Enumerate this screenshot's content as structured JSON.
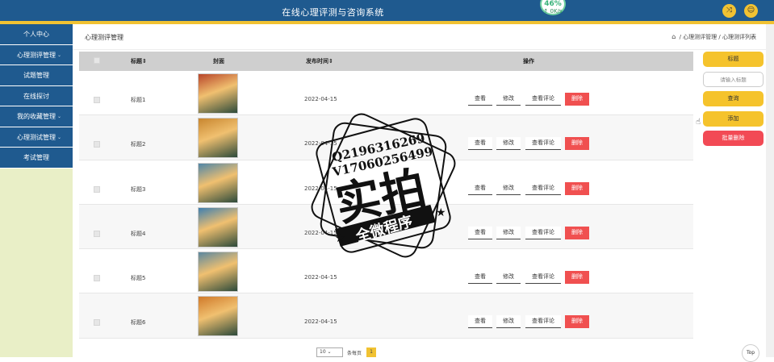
{
  "app": {
    "title": "在线心理评测与咨询系统"
  },
  "speed": {
    "value": "46%",
    "rate": "↑ 0K/s"
  },
  "topbar_icons": [
    "shuffle-icon",
    "user-icon"
  ],
  "sidebar": {
    "items": [
      {
        "label": "个人中心",
        "caret": false
      },
      {
        "label": "心理测评管理",
        "caret": true
      },
      {
        "label": "试题管理",
        "caret": false
      },
      {
        "label": "在线探讨",
        "caret": false
      },
      {
        "label": "我的收藏管理",
        "caret": true
      },
      {
        "label": "心理测试管理",
        "caret": true
      },
      {
        "label": "考试管理",
        "caret": false
      }
    ]
  },
  "content": {
    "page_title": "心理测评管理",
    "breadcrumb": [
      "心理测评管理",
      "心理测评列表"
    ],
    "breadcrumb_sep": "/"
  },
  "table": {
    "headers": {
      "title": "标题",
      "cover": "封面",
      "publish_time": "发布时间",
      "actions": "操作"
    },
    "rows": [
      {
        "title": "标题1",
        "date": "2022-04-15",
        "cover_color": "#b8452a"
      },
      {
        "title": "标题2",
        "date": "2022-04-15",
        "cover_color": "#c8862f"
      },
      {
        "title": "标题3",
        "date": "2022-04-15",
        "cover_color": "#4f86a8"
      },
      {
        "title": "标题4",
        "date": "2022-04-15",
        "cover_color": "#3e7fb0"
      },
      {
        "title": "标题5",
        "date": "2022-04-15",
        "cover_color": "#5b88a0"
      },
      {
        "title": "标题6",
        "date": "2022-04-15",
        "cover_color": "#d07a2a"
      }
    ],
    "actions": {
      "view": "查看",
      "edit": "修改",
      "view_comments": "查看评论",
      "delete": "删除"
    }
  },
  "right_panel": {
    "title_button": "标题",
    "search_placeholder": "请输入标题",
    "search_button": "查询",
    "add_button": "添加",
    "batch_delete_button": "批量删除"
  },
  "pagination": {
    "page_size": "10",
    "per_page_label": "条每页",
    "current_page": "1"
  },
  "back_to_top": "Top",
  "watermark": {
    "line1": "Q2196316269",
    "line2": "V17060256499",
    "main": "实拍",
    "banner": "全微程序"
  },
  "colors": {
    "primary": "#1f5a8f",
    "accent": "#f1c232",
    "danger": "#f05050",
    "sidebar_bg": "#e9efc7"
  }
}
